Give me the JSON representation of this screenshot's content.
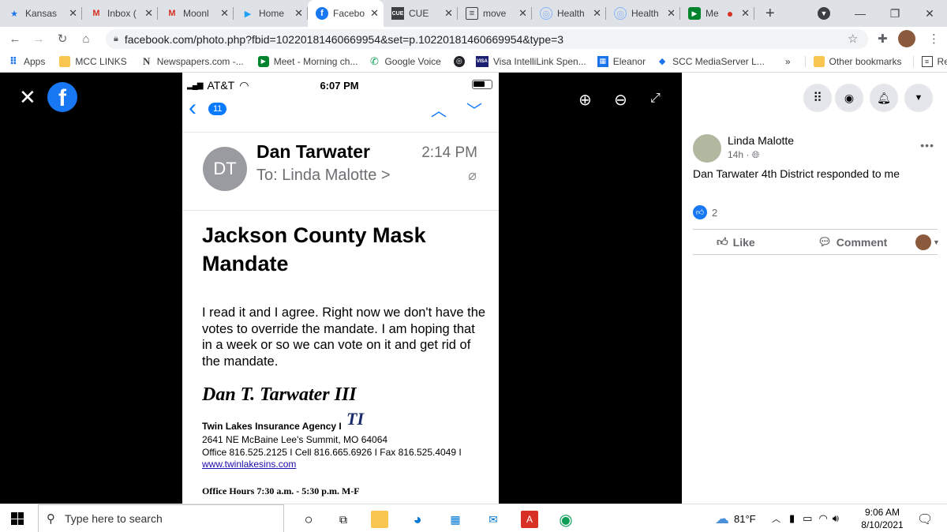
{
  "browser": {
    "tabs": [
      {
        "label": "Kansas",
        "icon": "star-icon",
        "color": "#1a73e8"
      },
      {
        "label": "Inbox (",
        "icon": "gmail-icon",
        "color": "#d93025"
      },
      {
        "label": "Moonl",
        "icon": "gmail-icon",
        "color": "#d93025"
      },
      {
        "label": "Home",
        "icon": "twitter-icon",
        "color": "#1da1f2"
      },
      {
        "label": "Facebo",
        "icon": "facebook-icon",
        "color": "#1877f2",
        "active": true
      },
      {
        "label": "CUE",
        "icon": "cue-icon",
        "color": "#3c4043"
      },
      {
        "label": "move",
        "icon": "doc-icon",
        "color": "#3c4043"
      },
      {
        "label": "Health",
        "icon": "globe-icon",
        "color": "#8ab4f8"
      },
      {
        "label": "Health",
        "icon": "globe-icon",
        "color": "#8ab4f8"
      },
      {
        "label": "Me",
        "icon": "meet-icon",
        "color": "#00832d"
      }
    ],
    "url": "facebook.com/photo.php?fbid=10220181460669954&set=p.10220181460669954&type=3",
    "bookmarks": [
      {
        "label": "Apps",
        "icon": "apps-grid-icon"
      },
      {
        "label": "MCC LINKS",
        "icon": "folder-icon"
      },
      {
        "label": "Newspapers.com -...",
        "icon": "newspapers-icon"
      },
      {
        "label": "Meet - Morning ch...",
        "icon": "meet-icon"
      },
      {
        "label": "Google Voice",
        "icon": "phone-icon"
      },
      {
        "label": "",
        "icon": "globe-icon"
      },
      {
        "label": "Visa IntelliLink Spen...",
        "icon": "visa-icon"
      },
      {
        "label": "Eleanor",
        "icon": "calendar-icon"
      },
      {
        "label": "SCC MediaServer L...",
        "icon": "media-icon"
      }
    ],
    "bookmarks_overflow": "»",
    "other_bookmarks": "Other bookmarks",
    "reading_list": "Reading list"
  },
  "phone": {
    "carrier": "AT&T",
    "time": "6:07 PM",
    "unread_count": "11",
    "avatar_initials": "DT",
    "sender": "Dan Tarwater",
    "sent_time": "2:14 PM",
    "to_label": "To: Linda Malotte >",
    "subject": "Jackson County Mask Mandate",
    "body": "I read it and I agree.  Right now we don't have the votes to override the mandate.  I am hoping that in a week or so we can vote on it and get rid of the mandate.",
    "signature_name": "Dan T. Tarwater III",
    "agency": "Twin Lakes Insurance Agency I",
    "address": "2641 NE McBaine Lee's Summit, MO 64064",
    "phones": "Office 816.525.2125 I Cell 816.665.6926 I Fax 816.525.4049 I",
    "website": "www.twinlakesins.com",
    "office_hours": "Office Hours 7:30 a.m. - 5:30 p.m. M-F"
  },
  "post": {
    "author": "Linda Malotte",
    "time": "14h",
    "caption": "Dan Tarwater 4th District responded to me",
    "like_count": "2",
    "like_label": "Like",
    "comment_label": "Comment"
  },
  "taskbar": {
    "search_placeholder": "Type here to search",
    "temperature": "81°F",
    "clock_time": "9:06 AM",
    "clock_date": "8/10/2021"
  }
}
